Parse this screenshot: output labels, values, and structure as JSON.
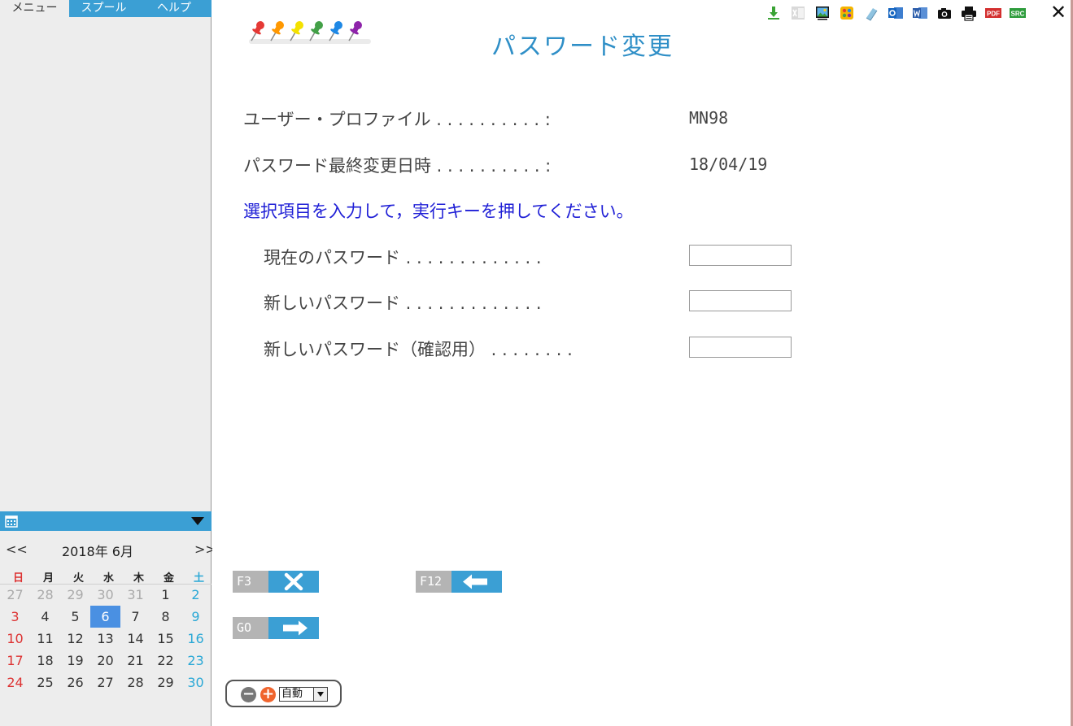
{
  "sidebar": {
    "tabs": [
      {
        "label": "メニュー"
      },
      {
        "label": "スプール"
      },
      {
        "label": "ヘルプ"
      }
    ]
  },
  "calendar": {
    "prev": "<<",
    "next": ">>",
    "title": "2018年 6月",
    "weekdays": [
      "日",
      "月",
      "火",
      "水",
      "木",
      "金",
      "土"
    ],
    "weeks": [
      [
        "27",
        "28",
        "29",
        "30",
        "31",
        "1",
        "2"
      ],
      [
        "3",
        "4",
        "5",
        "6",
        "7",
        "8",
        "9"
      ],
      [
        "10",
        "11",
        "12",
        "13",
        "14",
        "15",
        "16"
      ],
      [
        "17",
        "18",
        "19",
        "20",
        "21",
        "22",
        "23"
      ],
      [
        "24",
        "25",
        "26",
        "27",
        "28",
        "29",
        "30"
      ]
    ],
    "selected_day": "6"
  },
  "form": {
    "title": "パスワード変更",
    "profile_label": "ユーザー・プロファイル . . . . . . . . . . :",
    "profile_value": "MN98",
    "last_changed_label": "パスワード最終変更日時 . . . . . . . . . . :",
    "last_changed_value": "18/04/19",
    "instruction": "選択項目を入力して，実行キーを押してください。",
    "current_password_label": "現在のパスワード . . . . . . . . . . . . .",
    "current_password_value": "",
    "new_password_label": "新しいパスワード . . . . . . . . . . . . .",
    "new_password_value": "",
    "confirm_password_label": "新しいパスワード（確認用） . . . . . . . .",
    "confirm_password_value": ""
  },
  "function_keys": {
    "f3": "F3",
    "f12": "F12",
    "go": "GO"
  },
  "zoom": {
    "minus": "−",
    "plus": "+",
    "selected": "自動"
  },
  "toolbar": {
    "icons": [
      "download-icon",
      "excel-icon",
      "image-icon",
      "palette-icon",
      "clipboard-icon",
      "outlook-icon",
      "word-icon",
      "camera-icon",
      "print-icon",
      "pdf-icon",
      "src-icon",
      "close-icon"
    ],
    "pdf_text": "PDF",
    "src_text": "SRC",
    "close_text": "✕"
  },
  "colors": {
    "accent": "#3b9fd4",
    "title": "#2f8fc7",
    "instruction": "#1f1fd6",
    "sunday": "#dd3333",
    "saturday": "#2aa8d6",
    "today": "#4a90e2"
  }
}
